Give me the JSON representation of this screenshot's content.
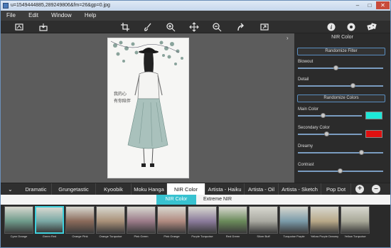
{
  "window": {
    "title": "u=1549444885,289249806&fm=26&gp=0.jpg",
    "minimize": "–",
    "maximize": "□",
    "close": "✕"
  },
  "menu": [
    "File",
    "Edit",
    "Window",
    "Help"
  ],
  "toolbar_icons": [
    "compare-icon",
    "save-icon",
    "crop-icon",
    "brush-icon",
    "zoom-in-icon",
    "move-icon",
    "zoom-out-icon",
    "redo-icon",
    "fit-icon",
    "info-icon",
    "settings-icon",
    "dice-icon"
  ],
  "photo": {
    "handwriting_line1": "我的心",
    "handwriting_line2": "有你陪伴"
  },
  "panel": {
    "title": "NIR Color",
    "randomize_filter": "Randomize Filter",
    "randomize_colors": "Randomize Colors",
    "sliders": [
      {
        "label": "Blowout",
        "value": 0.45
      },
      {
        "label": "Detail",
        "value": 0.65
      },
      {
        "label": "Main Color",
        "value": 0.4
      },
      {
        "label": "Secondary Color",
        "value": 0.45
      },
      {
        "label": "Dreamy",
        "value": 0.75
      },
      {
        "label": "Contrast",
        "value": 0.5
      }
    ],
    "main_color": "#1de8d8",
    "secondary_color": "#e01010"
  },
  "tabs": [
    "Dramatic",
    "Grungetastic",
    "Kyoobik",
    "Moku Hanga",
    "NIR Color",
    "Artista - Haiku",
    "Artista - Oil",
    "Artista - Sketch",
    "Pop Dot"
  ],
  "active_tab": "NIR Color",
  "add_label": "+",
  "remove_label": "–",
  "subtabs": [
    "NIR Color",
    "Extreme NIR"
  ],
  "thumbnails": [
    {
      "label": "Cyan Orange",
      "color": "#6e9a8a"
    },
    {
      "label": "Green Red",
      "color": "#7aa8a4",
      "selected": true
    },
    {
      "label": "Orange Pink",
      "color": "#8a6a5a"
    },
    {
      "label": "Orange Turquoise",
      "color": "#a89078"
    },
    {
      "label": "Pink Green",
      "color": "#9a7a88"
    },
    {
      "label": "Pink Orange",
      "color": "#b08a80"
    },
    {
      "label": "Purple Turquoise",
      "color": "#8a7a9a"
    },
    {
      "label": "Red Green",
      "color": "#6a8a5a"
    },
    {
      "label": "Silver Buff",
      "color": "#a8a8a0"
    },
    {
      "label": "Turquoise Purple",
      "color": "#7a9aa8"
    },
    {
      "label": "Yellow Purple Dreamy",
      "color": "#b8a888"
    },
    {
      "label": "Yellow Turquoise",
      "color": "#a8a898"
    }
  ]
}
